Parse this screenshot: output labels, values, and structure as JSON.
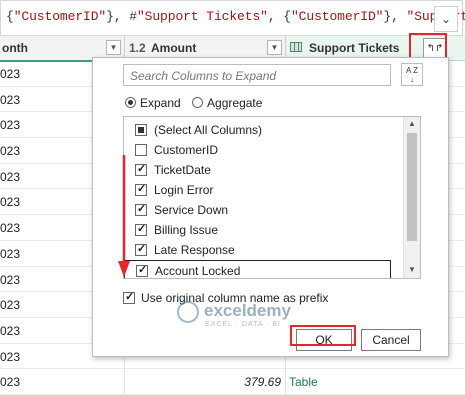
{
  "formula": {
    "tokens": [
      {
        "text": "{",
        "kind": "pun"
      },
      {
        "text": "\"CustomerID\"",
        "kind": "str"
      },
      {
        "text": "}, #",
        "kind": "pun"
      },
      {
        "text": "\"Support Tickets\"",
        "kind": "str"
      },
      {
        "text": ", {",
        "kind": "pun"
      },
      {
        "text": "\"CustomerID\"",
        "kind": "str"
      },
      {
        "text": "}, ",
        "kind": "pun"
      },
      {
        "text": "\"Support",
        "kind": "str"
      }
    ],
    "chevron": "⌄"
  },
  "grid": {
    "columns": {
      "month": "onth",
      "amount_type": "1.2",
      "amount": "Amount",
      "tickets": "Support Tickets"
    },
    "expand_icon": "↰↱",
    "rows": [
      {
        "month": "023",
        "amount": "",
        "tickets": ""
      },
      {
        "month": "023",
        "amount": "",
        "tickets": ""
      },
      {
        "month": "023",
        "amount": "",
        "tickets": ""
      },
      {
        "month": "023",
        "amount": "",
        "tickets": ""
      },
      {
        "month": "023",
        "amount": "",
        "tickets": ""
      },
      {
        "month": "023",
        "amount": "",
        "tickets": ""
      },
      {
        "month": "023",
        "amount": "",
        "tickets": ""
      },
      {
        "month": "023",
        "amount": "",
        "tickets": ""
      },
      {
        "month": "023",
        "amount": "",
        "tickets": ""
      },
      {
        "month": "023",
        "amount": "",
        "tickets": ""
      },
      {
        "month": "023",
        "amount": "",
        "tickets": ""
      },
      {
        "month": "023",
        "amount": "",
        "tickets": ""
      },
      {
        "month": "023",
        "amount": "379.69",
        "tickets": "Table"
      }
    ]
  },
  "popup": {
    "search_placeholder": "Search Columns to Expand",
    "sort_icon": "A Z",
    "mode_expand": "Expand",
    "mode_aggregate": "Aggregate",
    "selected_mode": "Expand",
    "columns": [
      {
        "label": "(Select All Columns)",
        "state": "partial"
      },
      {
        "label": "CustomerID",
        "state": "unchecked"
      },
      {
        "label": "TicketDate",
        "state": "checked"
      },
      {
        "label": "Login Error",
        "state": "checked"
      },
      {
        "label": "Service Down",
        "state": "checked"
      },
      {
        "label": "Billing Issue",
        "state": "checked"
      },
      {
        "label": "Late Response",
        "state": "checked"
      },
      {
        "label": "Account Locked",
        "state": "checked"
      }
    ],
    "prefix_label": "Use original column name as prefix",
    "prefix_checked": true,
    "ok": "OK",
    "cancel": "Cancel"
  },
  "watermark": {
    "name": "exceldemy",
    "sub": "EXCEL · DATA · BI"
  },
  "colors": {
    "annotation": "#e8262a",
    "table_link": "#237a4f",
    "tickets_header_bg": "#e9f5ef"
  }
}
